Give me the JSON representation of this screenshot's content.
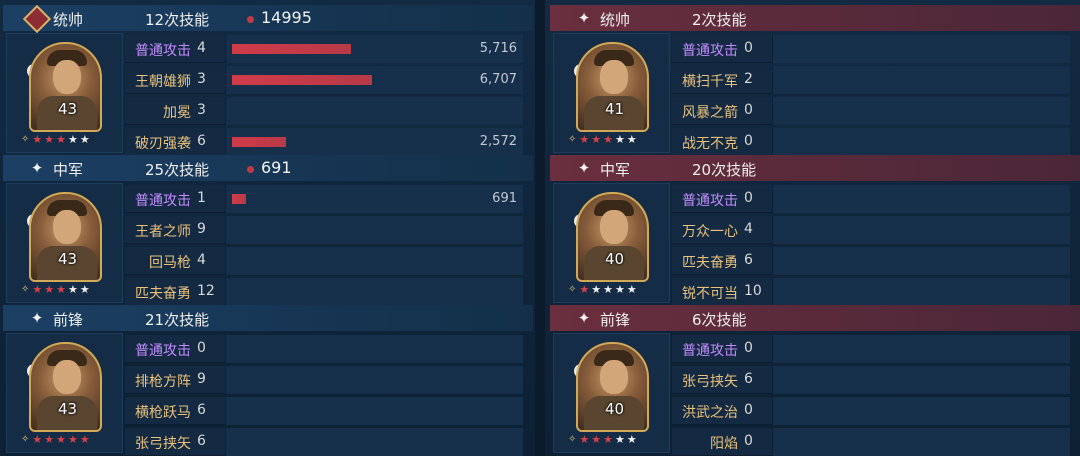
{
  "panels": [
    {
      "side": "left",
      "sections": [
        {
          "role": "统帅",
          "role_icon": "commander-badge-icon",
          "count": "12次技能",
          "total": "14995",
          "level": "43",
          "stars_on": 3,
          "skills": [
            {
              "name": "普通攻击",
              "count": "4",
              "damage": "5,716",
              "value": 5716,
              "normal": true
            },
            {
              "name": "王朝雄狮",
              "count": "3",
              "damage": "6,707",
              "value": 6707
            },
            {
              "name": "加冕",
              "count": "3",
              "damage": "",
              "value": 0
            },
            {
              "name": "破刃强袭",
              "count": "6",
              "damage": "2,572",
              "value": 2572
            }
          ]
        },
        {
          "role": "中军",
          "role_icon": "star-icon",
          "count": "25次技能",
          "total": "691",
          "level": "43",
          "stars_on": 3,
          "skills": [
            {
              "name": "普通攻击",
              "count": "1",
              "damage": "691",
              "value": 691,
              "normal": true
            },
            {
              "name": "王者之师",
              "count": "9",
              "damage": "",
              "value": 0
            },
            {
              "name": "回马枪",
              "count": "4",
              "damage": "",
              "value": 0
            },
            {
              "name": "匹夫奋勇",
              "count": "12",
              "damage": "",
              "value": 0
            }
          ]
        },
        {
          "role": "前锋",
          "role_icon": "star-icon",
          "count": "21次技能",
          "total": "",
          "level": "43",
          "stars_on": 5,
          "skills": [
            {
              "name": "普通攻击",
              "count": "0",
              "damage": "",
              "value": 0,
              "normal": true
            },
            {
              "name": "排枪方阵",
              "count": "9",
              "damage": "",
              "value": 0
            },
            {
              "name": "横枪跃马",
              "count": "6",
              "damage": "",
              "value": 0
            },
            {
              "name": "张弓挟矢",
              "count": "6",
              "damage": "",
              "value": 0
            }
          ]
        }
      ]
    },
    {
      "side": "right",
      "sections": [
        {
          "role": "统帅",
          "role_icon": "star-icon",
          "count": "2次技能",
          "total": "",
          "level": "41",
          "stars_on": 3,
          "skills": [
            {
              "name": "普通攻击",
              "count": "0",
              "damage": "",
              "value": 0,
              "normal": true
            },
            {
              "name": "横扫千军",
              "count": "2",
              "damage": "",
              "value": 0
            },
            {
              "name": "风暴之箭",
              "count": "0",
              "damage": "",
              "value": 0
            },
            {
              "name": "战无不克",
              "count": "0",
              "damage": "",
              "value": 0
            }
          ]
        },
        {
          "role": "中军",
          "role_icon": "star-icon",
          "count": "20次技能",
          "total": "",
          "level": "40",
          "stars_on": 1,
          "skills": [
            {
              "name": "普通攻击",
              "count": "0",
              "damage": "",
              "value": 0,
              "normal": true
            },
            {
              "name": "万众一心",
              "count": "4",
              "damage": "",
              "value": 0
            },
            {
              "name": "匹夫奋勇",
              "count": "6",
              "damage": "",
              "value": 0
            },
            {
              "name": "锐不可当",
              "count": "10",
              "damage": "",
              "value": 0
            }
          ]
        },
        {
          "role": "前锋",
          "role_icon": "star-icon",
          "count": "6次技能",
          "total": "",
          "level": "40",
          "stars_on": 3,
          "skills": [
            {
              "name": "普通攻击",
              "count": "0",
              "damage": "",
              "value": 0,
              "normal": true
            },
            {
              "name": "张弓挟矢",
              "count": "6",
              "damage": "",
              "value": 0
            },
            {
              "name": "洪武之治",
              "count": "0",
              "damage": "",
              "value": 0
            },
            {
              "name": "阳焰",
              "count": "0",
              "damage": "",
              "value": 0
            }
          ]
        }
      ]
    }
  ],
  "max_damage": 6707,
  "colors": {
    "bar": "#d13b48",
    "normal_skill": "#c48cff",
    "skill": "#eac17a"
  }
}
